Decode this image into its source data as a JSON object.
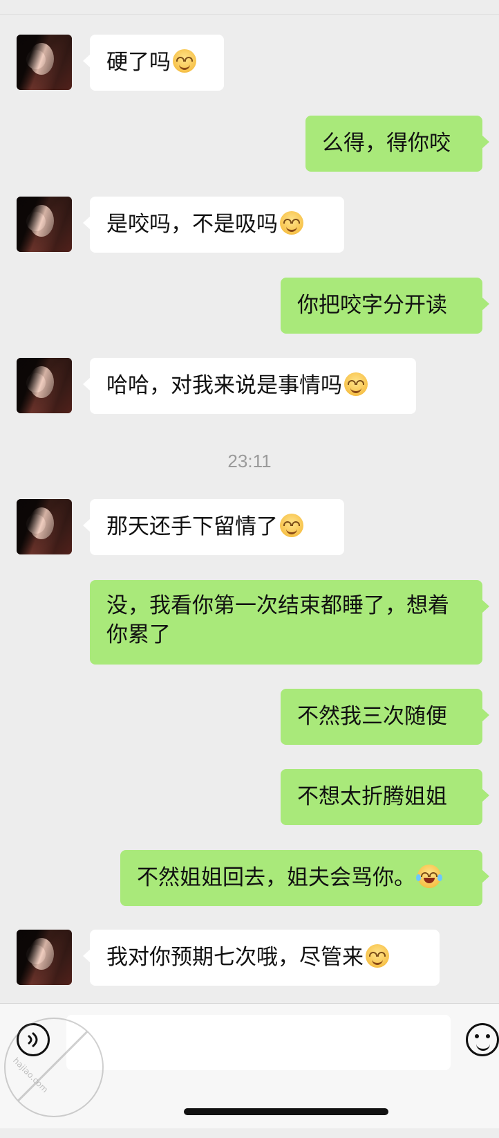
{
  "chat": {
    "messages": [
      {
        "side": "left",
        "text": "硬了吗",
        "emoji": "smirk-face"
      },
      {
        "side": "right",
        "text": "么得，得你咬"
      },
      {
        "side": "left",
        "text": "是咬吗，不是吸吗",
        "emoji": "smirk-face"
      },
      {
        "side": "right",
        "text": "你把咬字分开读"
      },
      {
        "side": "left",
        "text": "哈哈，对我来说是事情吗",
        "emoji": "smirk-face"
      },
      {
        "type": "time",
        "text": "23:11"
      },
      {
        "side": "left",
        "text": "那天还手下留情了",
        "emoji": "smirk-face"
      },
      {
        "side": "right",
        "text": "没，我看你第一次结束都睡了，想着你累了"
      },
      {
        "side": "right",
        "text": "不然我三次随便"
      },
      {
        "side": "right",
        "text": "不想太折腾姐姐"
      },
      {
        "side": "right",
        "text": "不然姐姐回去，姐夫会骂你。",
        "emoji": "laughing-tears-face"
      },
      {
        "side": "left",
        "text": "我对你预期七次哦，尽管来",
        "emoji": "smirk-face"
      }
    ]
  },
  "watermark": {
    "text": "hajiao.com"
  }
}
